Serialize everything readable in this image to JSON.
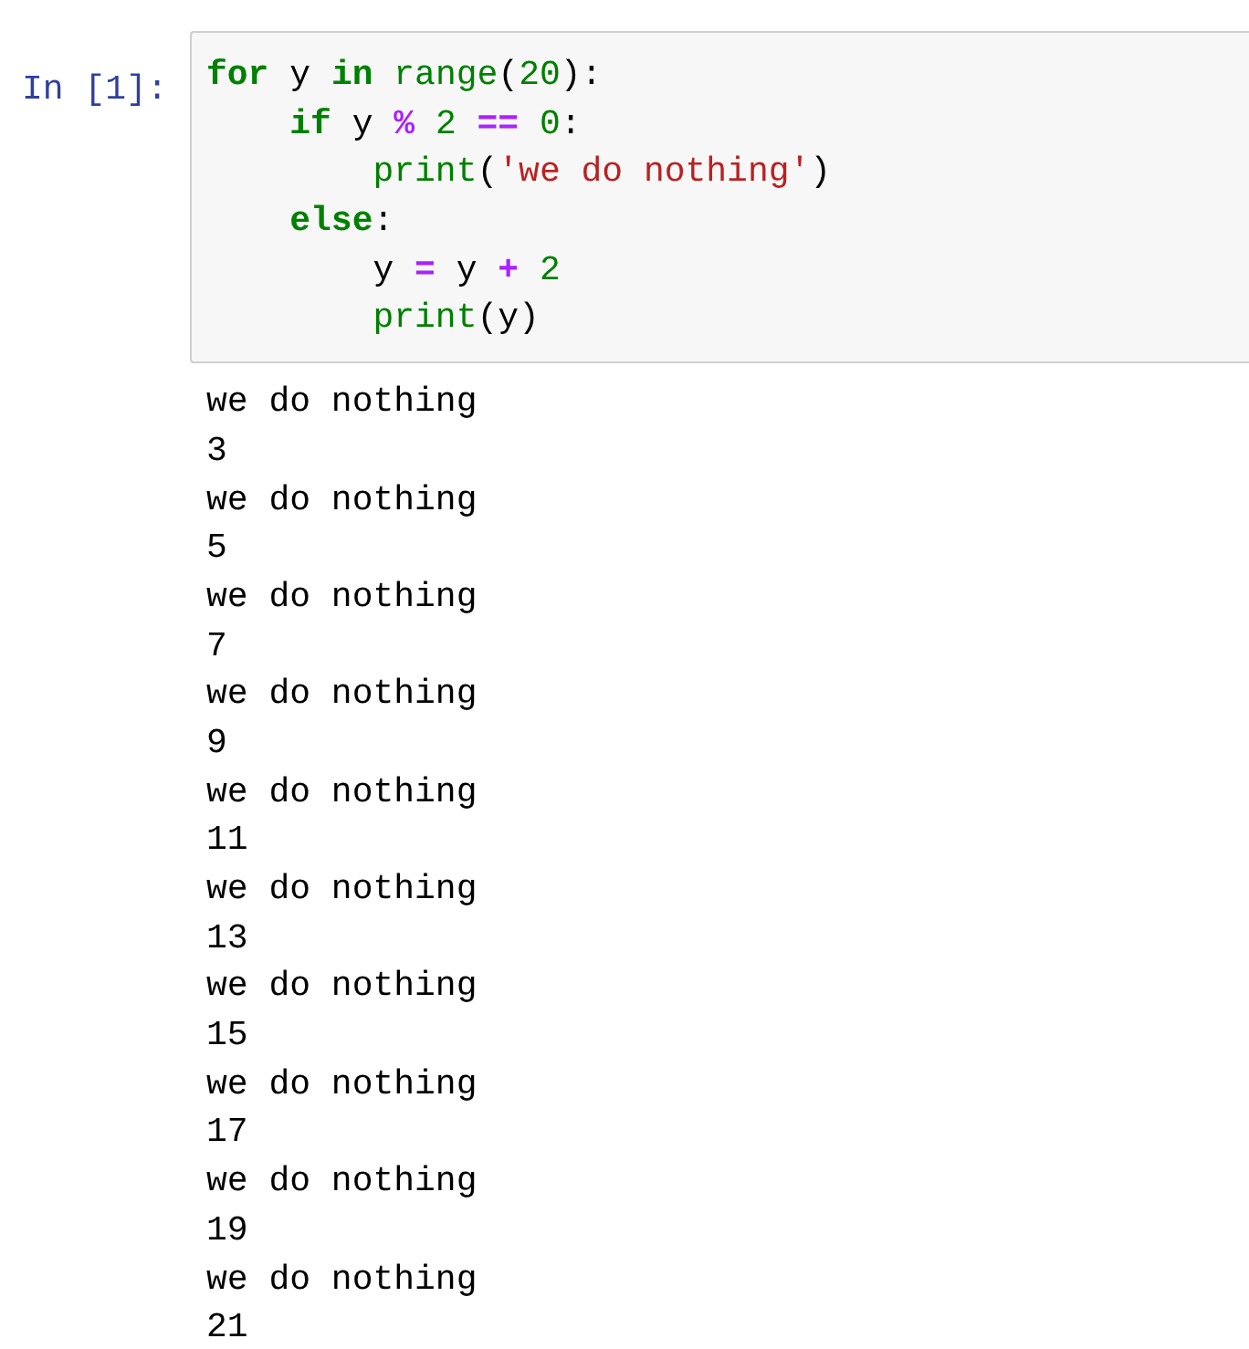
{
  "cell": {
    "prompt": "In [1]:",
    "code_lines": [
      {
        "tokens": [
          {
            "kind": "keyword",
            "text": "for"
          },
          {
            "kind": "text",
            "text": " y "
          },
          {
            "kind": "keyword",
            "text": "in"
          },
          {
            "kind": "builtin",
            "text": " range"
          },
          {
            "kind": "text",
            "text": "("
          },
          {
            "kind": "number",
            "text": "20"
          },
          {
            "kind": "text",
            "text": "):"
          }
        ]
      },
      {
        "tokens": [
          {
            "kind": "keyword",
            "text": "    if"
          },
          {
            "kind": "text",
            "text": " y "
          },
          {
            "kind": "operator",
            "text": "% "
          },
          {
            "kind": "number",
            "text": "2 "
          },
          {
            "kind": "operator",
            "text": "== "
          },
          {
            "kind": "number",
            "text": "0"
          },
          {
            "kind": "text",
            "text": ":"
          }
        ]
      },
      {
        "tokens": [
          {
            "kind": "builtin",
            "text": "        print"
          },
          {
            "kind": "text",
            "text": "("
          },
          {
            "kind": "string",
            "text": "'we do nothing'"
          },
          {
            "kind": "text",
            "text": ")"
          }
        ]
      },
      {
        "tokens": [
          {
            "kind": "keyword",
            "text": "    else"
          },
          {
            "kind": "text",
            "text": ":"
          }
        ]
      },
      {
        "tokens": [
          {
            "kind": "text",
            "text": "        y "
          },
          {
            "kind": "operator",
            "text": "="
          },
          {
            "kind": "text",
            "text": " y "
          },
          {
            "kind": "operator",
            "text": "+ "
          },
          {
            "kind": "number",
            "text": "2"
          }
        ]
      },
      {
        "tokens": [
          {
            "kind": "builtin",
            "text": "        print"
          },
          {
            "kind": "text",
            "text": "(y)"
          }
        ]
      }
    ]
  },
  "output_lines": [
    "we do nothing",
    "3",
    "we do nothing",
    "5",
    "we do nothing",
    "7",
    "we do nothing",
    "9",
    "we do nothing",
    "11",
    "we do nothing",
    "13",
    "we do nothing",
    "15",
    "we do nothing",
    "17",
    "we do nothing",
    "19",
    "we do nothing",
    "21"
  ]
}
